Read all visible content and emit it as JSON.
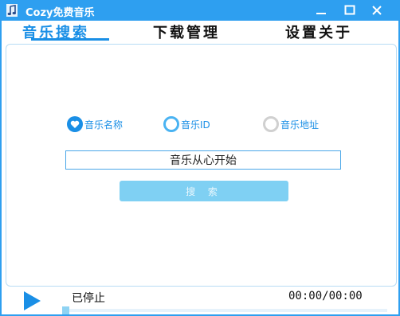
{
  "window": {
    "title": "Cozy免费音乐",
    "accent_color": "#2e9ff0"
  },
  "tabs": [
    {
      "label": "音乐搜索",
      "active": true
    },
    {
      "label": "下载管理",
      "active": false
    },
    {
      "label": "设置关于",
      "active": false
    }
  ],
  "search": {
    "modes": [
      {
        "label": "音乐名称",
        "selected": true,
        "icon": "heart-check-icon"
      },
      {
        "label": "音乐ID",
        "selected": false,
        "icon": "ring-icon"
      },
      {
        "label": "音乐地址",
        "selected": false,
        "icon": "ring-icon"
      }
    ],
    "input_value": "音乐从心开始",
    "button_label": "搜 索"
  },
  "player": {
    "status": "已停止",
    "time": "00:00/00:00",
    "progress": 0
  }
}
